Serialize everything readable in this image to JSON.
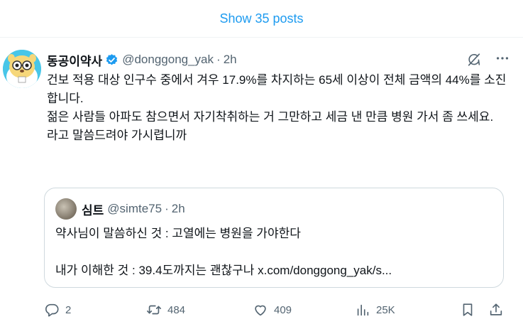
{
  "show_posts": {
    "label": "Show 35 posts"
  },
  "post": {
    "author_name": "동공이약사",
    "handle": "@donggong_yak",
    "separator": "·",
    "time": "2h",
    "text_lines": [
      "건보 적용 대상 인구수 중에서 겨우 17.9%를 차지하는 65세 이상이 전체 금액의 44%를 소진합니다.",
      "젊은 사람들 아파도 참으면서 자기착취하는 거 그만하고 세금 낸 만큼 병원 가서 좀 쓰세요.",
      "",
      "라고 말씀드려야 가시렵니까"
    ],
    "verified_color": "#1d9bf0"
  },
  "quote": {
    "author_name": "심트",
    "handle": "@simte75",
    "separator": "·",
    "time": "2h",
    "text_lines": [
      "약사님이 말씀하신 것 : 고열에는 병원을 가야한다",
      "",
      "내가 이해한 것 : 39.4도까지는 괜찮구나 x.com/donggong_yak/s..."
    ]
  },
  "actions": {
    "replies": "2",
    "reposts": "484",
    "likes": "409",
    "views": "25K"
  },
  "icons": {
    "verified": "verified-badge-icon",
    "grok": "grok-icon",
    "more": "more-icon",
    "reply": "reply-icon",
    "repost": "repost-icon",
    "like": "heart-icon",
    "views": "views-chart-icon",
    "bookmark": "bookmark-icon",
    "share": "share-icon"
  },
  "colors": {
    "accent": "#1d9bf0",
    "text": "#0f1419",
    "secondary": "#536471",
    "border": "#cfd9de"
  }
}
